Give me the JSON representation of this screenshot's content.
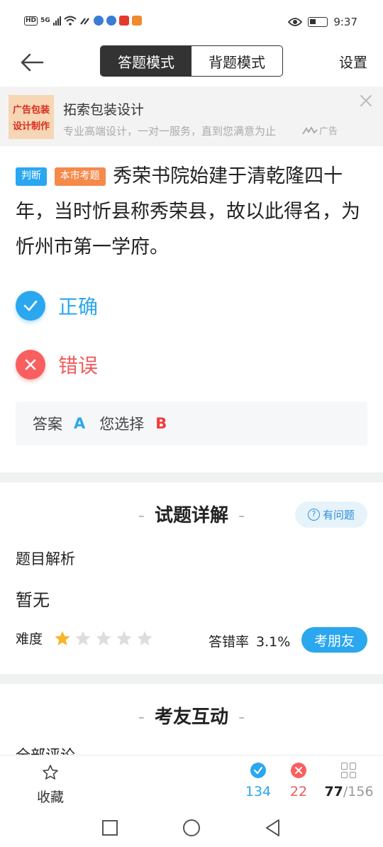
{
  "status_bar": {
    "left_hd": "HD",
    "left_5g": "5G",
    "time": "9:37"
  },
  "nav": {
    "mode_answer": "答题模式",
    "mode_memorize": "背题模式",
    "settings": "设置"
  },
  "ad": {
    "image_line1": "广告包装",
    "image_line2": "设计制作",
    "title": "拓索包装设计",
    "description": "专业高端设计，一对一服务，直到您满意为止",
    "tag": "广告"
  },
  "question": {
    "tag_type": "判断",
    "tag_source": "本市考题",
    "text": "秀荣书院始建于清乾隆四十年，当时忻县称秀荣县，故以此得名，为忻州市第一学府。"
  },
  "options": {
    "correct_label": "正确",
    "wrong_label": "错误"
  },
  "answer": {
    "answer_label": "答案",
    "answer_value": "A",
    "choice_label": "您选择",
    "choice_value": "B"
  },
  "explain": {
    "title": "试题详解",
    "ask_button": "有问题",
    "analysis_label": "题目解析",
    "analysis_text": "暂无",
    "difficulty_label": "难度",
    "difficulty_stars": 1,
    "difficulty_max": 5,
    "error_rate_label": "答错率",
    "error_rate_value": "3.1%",
    "test_friend_button": "考朋友"
  },
  "interaction": {
    "title": "考友互动",
    "clipped_text": "全部评论"
  },
  "bottom_bar": {
    "favorite_label": "收藏",
    "correct_count": "134",
    "wrong_count": "22",
    "current_index": "77",
    "total": "/156"
  },
  "colors": {
    "accent_blue": "#2ba7ef",
    "error_red": "#fa5f5f",
    "tag_orange": "#f58a4b",
    "star_gold": "#f7b52c"
  }
}
